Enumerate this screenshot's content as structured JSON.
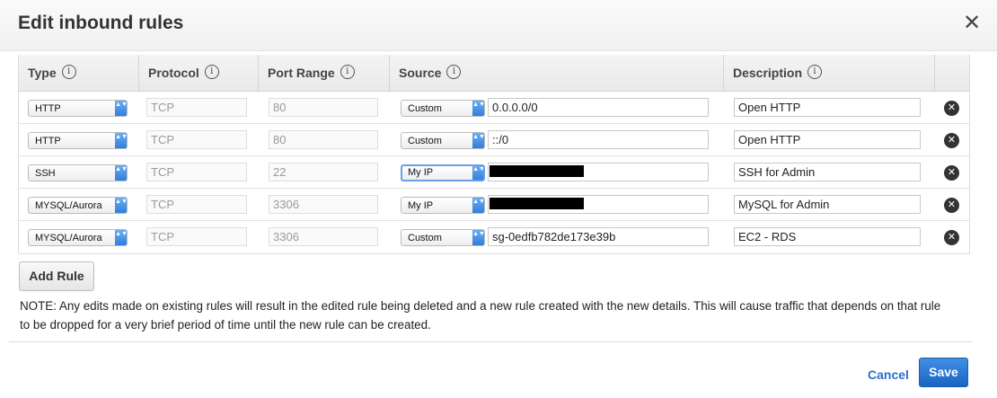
{
  "dialog": {
    "title": "Edit inbound rules",
    "close_glyph": "✕"
  },
  "table": {
    "headers": {
      "type": "Type",
      "protocol": "Protocol",
      "port_range": "Port Range",
      "source": "Source",
      "description": "Description"
    },
    "info_glyph": "i",
    "rows": [
      {
        "type": "HTTP",
        "protocol": "TCP",
        "port": "80",
        "source_type": "Custom",
        "source_value": "0.0.0.0/0",
        "description": "Open HTTP",
        "redacted": false
      },
      {
        "type": "HTTP",
        "protocol": "TCP",
        "port": "80",
        "source_type": "Custom",
        "source_value": "::/0",
        "description": "Open HTTP",
        "redacted": false
      },
      {
        "type": "SSH",
        "protocol": "TCP",
        "port": "22",
        "source_type": "My IP",
        "source_value": "",
        "description": "SSH for Admin",
        "redacted": true
      },
      {
        "type": "MYSQL/Aurora",
        "protocol": "TCP",
        "port": "3306",
        "source_type": "My IP",
        "source_value": "",
        "description": "MySQL for Admin",
        "redacted": true
      },
      {
        "type": "MYSQL/Aurora",
        "protocol": "TCP",
        "port": "3306",
        "source_type": "Custom",
        "source_value": "sg-0edfb782de173e39b",
        "description": "EC2 - RDS",
        "redacted": false
      }
    ]
  },
  "actions": {
    "add_rule": "Add Rule",
    "cancel": "Cancel",
    "save": "Save"
  },
  "note": "NOTE: Any edits made on existing rules will result in the edited rule being deleted and a new rule created with the new details. This will cause traffic that depends on that rule to be dropped for a very brief period of time until the new rule can be created.",
  "glyphs": {
    "select_arrows": "▲▼",
    "delete": "✕"
  },
  "colors": {
    "accent": "#2a71c9",
    "save_button": "#1b63c4",
    "select_arrow": "#2d7bd9"
  }
}
